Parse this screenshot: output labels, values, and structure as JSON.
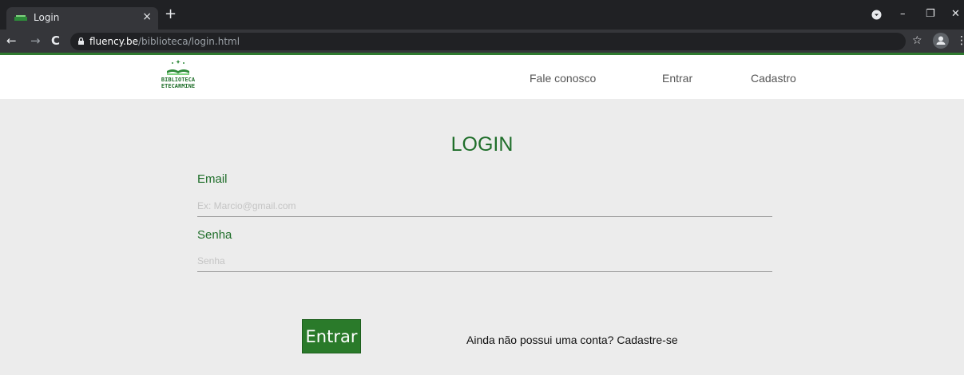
{
  "browser": {
    "tab_title": "Login",
    "tab_close": "×",
    "new_tab": "+",
    "url_host": "fluency.be",
    "url_path": "/biblioteca/login.html",
    "back_icon": "←",
    "forward_icon": "→",
    "reload_icon": "C",
    "star_icon": "☆",
    "menu_icon": "⋮",
    "minimize_icon": "–",
    "restore_icon": "❐",
    "close_icon": "✕"
  },
  "header": {
    "logo_line1": "BIBLIOTECA",
    "logo_line2": "ETECARMINE",
    "nav": [
      "Fale conosco",
      "Entrar",
      "Cadastro"
    ]
  },
  "form": {
    "title": "LOGIN",
    "email_label": "Email",
    "email_placeholder": "Ex: Marcio@gmail.com",
    "password_label": "Senha",
    "password_placeholder": "Senha",
    "submit_label": "Entrar",
    "signup_text": "Ainda não possui uma conta? Cadastre-se"
  },
  "colors": {
    "brand_green": "#1f6e2a",
    "button_green": "#2a7a2a",
    "page_bg": "#ececec"
  }
}
